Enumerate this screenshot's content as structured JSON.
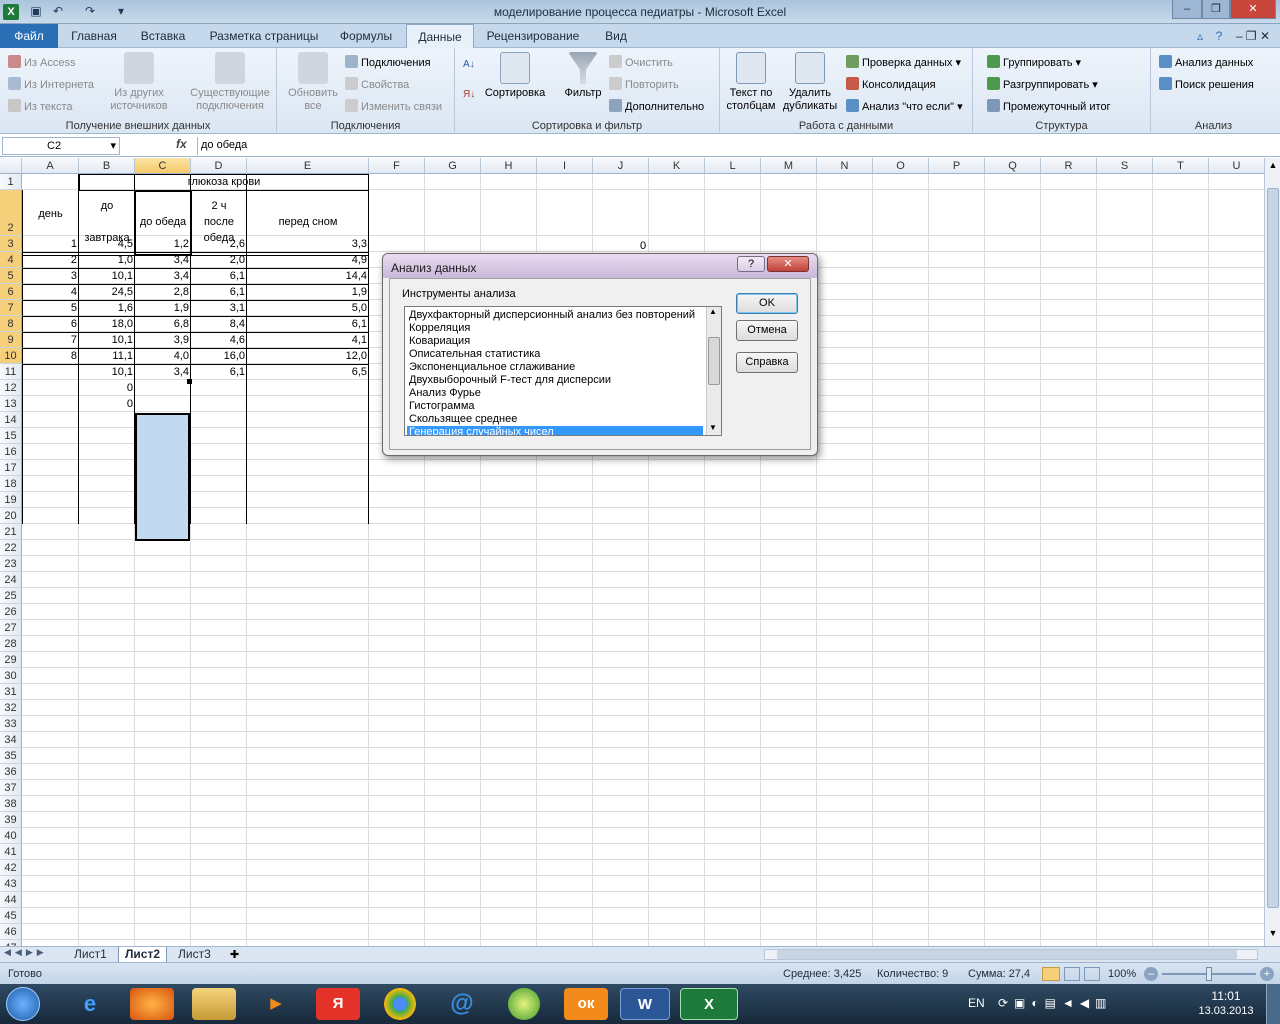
{
  "app": {
    "title": "моделирование процесса  педиатры - Microsoft Excel",
    "icon": "excel-icon"
  },
  "tabs": [
    "Файл",
    "Главная",
    "Вставка",
    "Разметка страницы",
    "Формулы",
    "Данные",
    "Рецензирование",
    "Вид"
  ],
  "ribbon": {
    "external": {
      "label": "Получение внешних данных",
      "access": "Из Access",
      "web": "Из Интернета",
      "text": "Из текста",
      "other_1": "Из других",
      "other_2": "источников",
      "existing_1": "Существующие",
      "existing_2": "подключения"
    },
    "connections": {
      "label": "Подключения",
      "refresh_1": "Обновить",
      "refresh_2": "все",
      "connections": "Подключения",
      "properties": "Свойства",
      "edit_links": "Изменить связи"
    },
    "sort": {
      "label": "Сортировка и фильтр",
      "sort": "Сортировка",
      "filter": "Фильтр",
      "clear": "Очистить",
      "reapply": "Повторить",
      "advanced": "Дополнительно"
    },
    "tools": {
      "label": "Работа с данными",
      "text_cols_1": "Текст по",
      "text_cols_2": "столбцам",
      "dupes_1": "Удалить",
      "dupes_2": "дубликаты",
      "validation": "Проверка данных",
      "consolidate": "Консолидация",
      "whatif": "Анализ \"что если\""
    },
    "outline": {
      "label": "Структура",
      "group": "Группировать",
      "ungroup": "Разгруппировать",
      "subtotal": "Промежуточный итог"
    },
    "analysis": {
      "label": "Анализ",
      "data_analysis": "Анализ данных",
      "solver": "Поиск решения"
    }
  },
  "formula_bar": {
    "name_box": "C2",
    "fx": "fx",
    "formula": "до обеда"
  },
  "columns": [
    "A",
    "B",
    "C",
    "D",
    "E",
    "F",
    "G",
    "H",
    "I",
    "J",
    "K",
    "L",
    "M",
    "N",
    "O",
    "P",
    "Q",
    "R",
    "S",
    "T",
    "U"
  ],
  "sheet": {
    "header_glucose": "глюкоза крови",
    "header_day": "день",
    "header_breakfast_1": "до",
    "header_breakfast_2": "завтрака",
    "header_lunch": "до обеда",
    "header_after_1": "2 ч",
    "header_after_2": "после",
    "header_after_3": "обеда",
    "header_sleep": "перед сном",
    "stray_zero": "0",
    "rows": [
      [
        "1",
        "4,5",
        "1,2",
        "2,6",
        "3,3"
      ],
      [
        "2",
        "1,0",
        "3,4",
        "2,0",
        "4,9"
      ],
      [
        "3",
        "10,1",
        "3,4",
        "6,1",
        "14,4"
      ],
      [
        "4",
        "24,5",
        "2,8",
        "6,1",
        "1,9"
      ],
      [
        "5",
        "1,6",
        "1,9",
        "3,1",
        "5,0"
      ],
      [
        "6",
        "18,0",
        "6,8",
        "8,4",
        "6,1"
      ],
      [
        "7",
        "10,1",
        "3,9",
        "4,6",
        "4,1"
      ],
      [
        "8",
        "11,1",
        "4,0",
        "16,0",
        "12,0"
      ]
    ],
    "totals": [
      "10,1",
      "3,4",
      "6,1",
      "6,5"
    ],
    "extra_b12": "0",
    "extra_b13": "0"
  },
  "sheet_tabs": [
    "Лист1",
    "Лист2",
    "Лист3"
  ],
  "status": {
    "ready": "Готово",
    "average": "Среднее: 3,425",
    "count": "Количество: 9",
    "sum": "Сумма: 27,4",
    "zoom": "100%"
  },
  "dialog": {
    "title": "Анализ данных",
    "group_label": "Инструменты анализа",
    "items": [
      "Двухфакторный дисперсионный анализ без повторений",
      "Корреляция",
      "Ковариация",
      "Описательная статистика",
      "Экспоненциальное сглаживание",
      "Двухвыборочный F-тест для дисперсии",
      "Анализ Фурье",
      "Гистограмма",
      "Скользящее среднее",
      "Генерация случайных чисел"
    ],
    "selected": "Генерация случайных чисел",
    "ok": "OK",
    "cancel": "Отмена",
    "help": "Справка"
  },
  "taskbar": {
    "lang": "EN",
    "time": "11:01",
    "date": "13.03.2013"
  }
}
